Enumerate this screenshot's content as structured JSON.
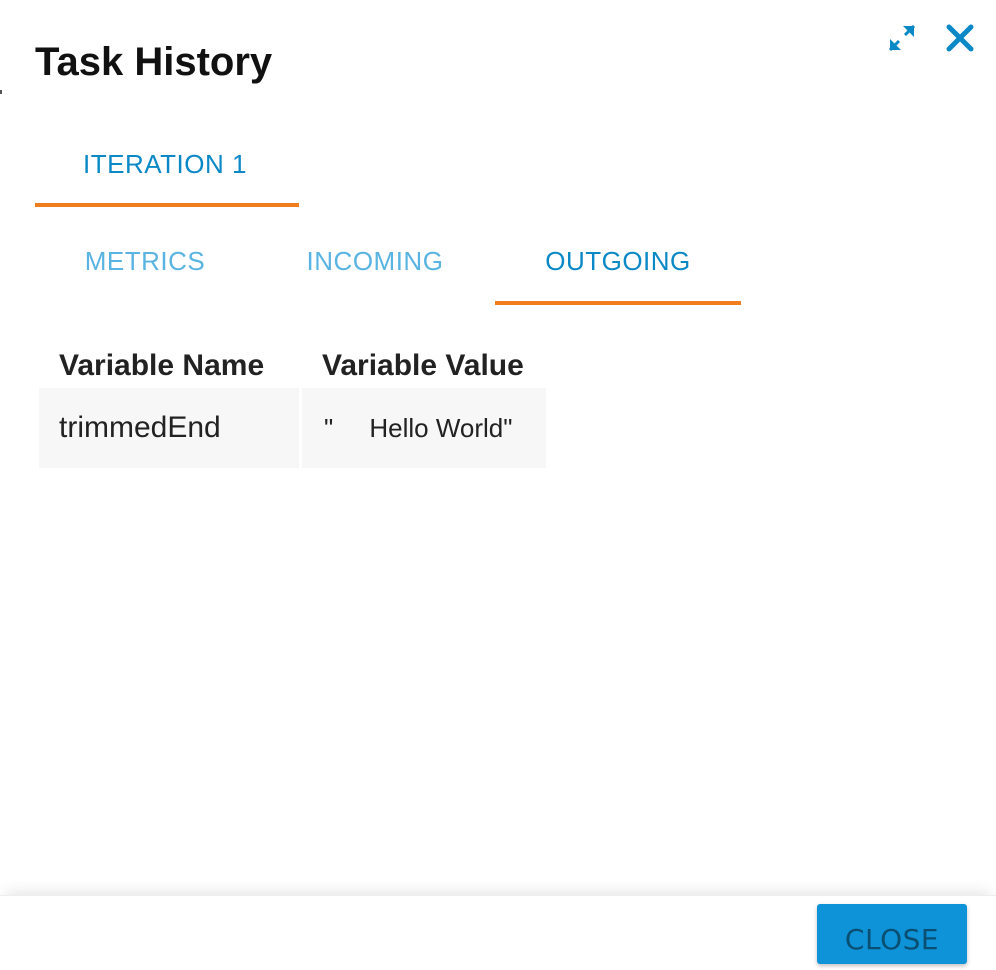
{
  "dialog": {
    "title": "Task History",
    "icons": {
      "minimize": "collapse-arrows-icon",
      "close": "close-x-icon"
    },
    "accent_color": "#0b88c6",
    "tab_indicator_color": "#f07e1f"
  },
  "iteration_tabs": [
    {
      "label": "ITERATION 1",
      "active": true
    }
  ],
  "sub_tabs": [
    {
      "label": "METRICS",
      "active": false
    },
    {
      "label": "INCOMING",
      "active": false
    },
    {
      "label": "OUTGOING",
      "active": true
    }
  ],
  "variables": {
    "headers": [
      "Variable Name",
      "Variable Value"
    ],
    "rows": [
      {
        "name": "trimmedEnd",
        "value": "\"     Hello World\""
      }
    ]
  },
  "footer": {
    "close_label": "CLOSE"
  }
}
